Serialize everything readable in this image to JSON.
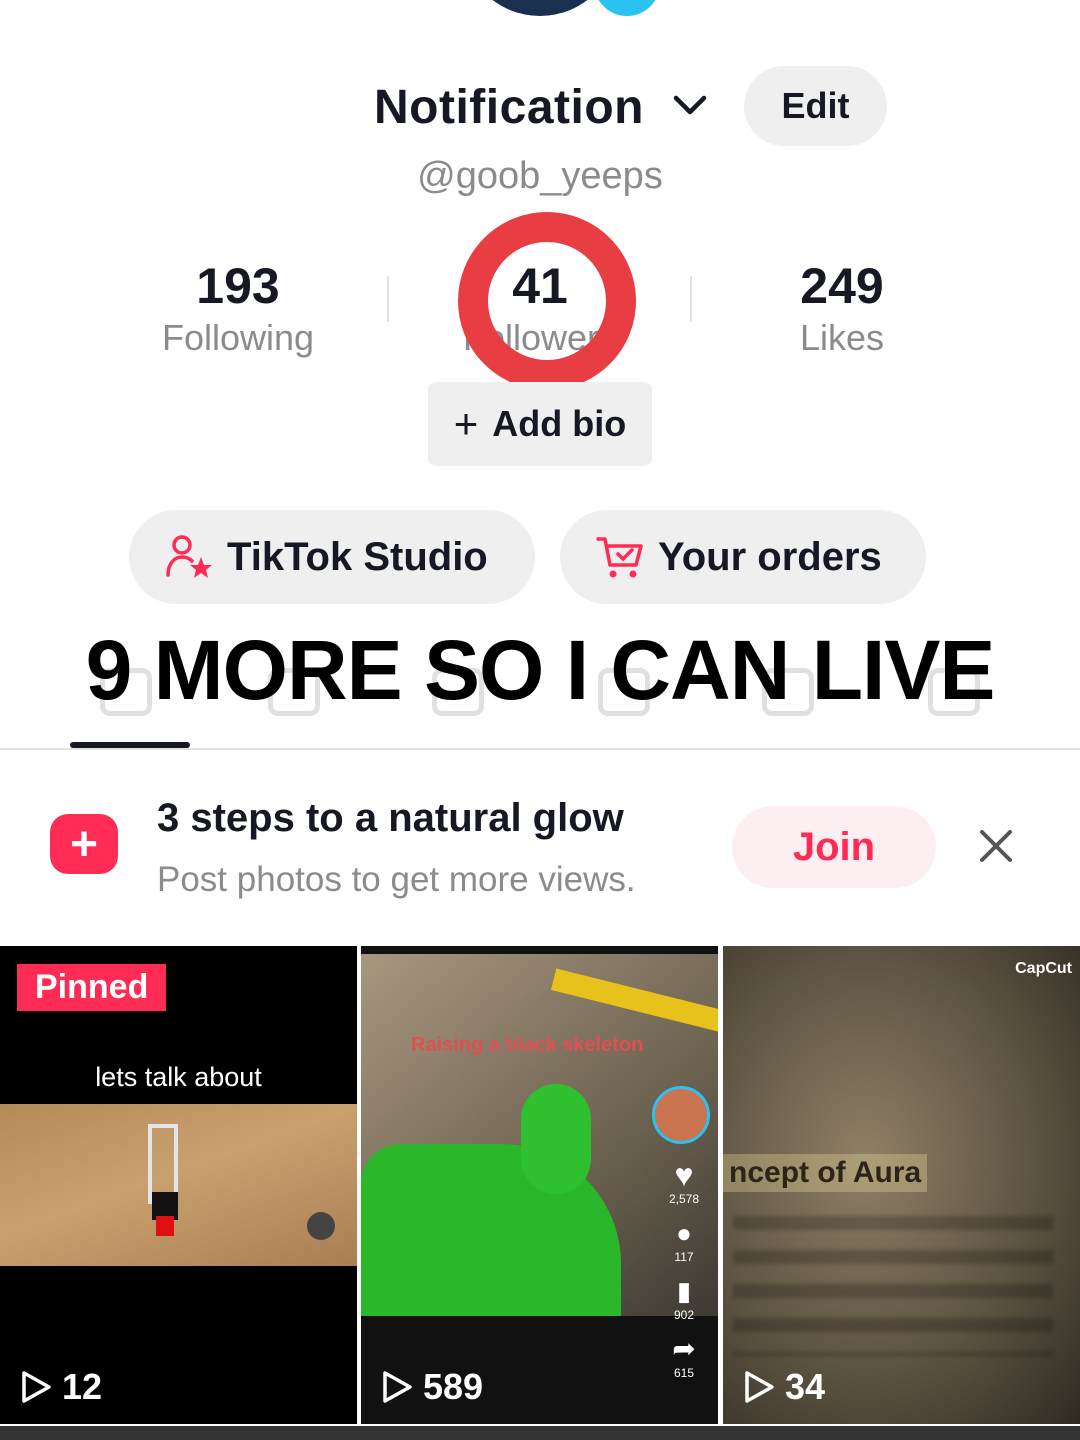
{
  "profile": {
    "display_name": "Notification",
    "edit_label": "Edit",
    "username": "@goob_yeeps",
    "add_bio_label": "Add bio"
  },
  "stats": [
    {
      "value": "193",
      "label": "Following"
    },
    {
      "value": "41",
      "label": "Followers"
    },
    {
      "value": "249",
      "label": "Likes"
    }
  ],
  "buttons": {
    "studio": "TikTok Studio",
    "orders": "Your orders"
  },
  "overlay_caption": "9 MORE SO I CAN LIVE",
  "promo": {
    "title": "3 steps to a natural glow",
    "subtitle": "Post photos to get more views.",
    "join_label": "Join"
  },
  "videos": [
    {
      "badge": "Pinned",
      "caption": "lets talk about",
      "plays": "12"
    },
    {
      "caption": "Raising a black skeleton",
      "plays": "589",
      "likes": "2,578",
      "comments": "117",
      "saves": "902",
      "shares": "615"
    },
    {
      "caption": "ncept of Aura",
      "plays": "34",
      "watermark": "CapCut"
    }
  ],
  "colors": {
    "accent": "#fe2c55",
    "annotation_ring": "#e83d43",
    "muted_text": "#8a8b91"
  }
}
